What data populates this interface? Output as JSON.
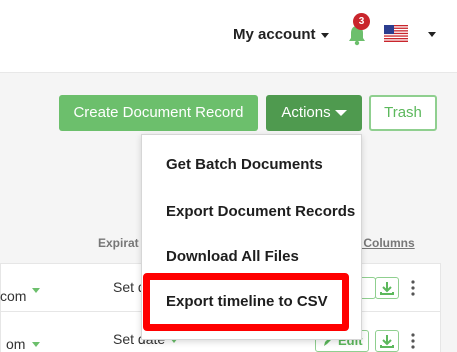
{
  "header": {
    "account_label": "My account",
    "notifications_count": "3",
    "flag": "us-flag-icon"
  },
  "toolbar": {
    "create_label": "Create Document Record",
    "actions_label": "Actions",
    "trash_label": "Trash"
  },
  "table": {
    "col_expiration": "Expirat",
    "col_columns": "t Columns",
    "rows": [
      {
        "email_fragment": "com",
        "expiry": "Set d"
      },
      {
        "email_fragment": "om",
        "expiry": "Set date",
        "edit_label": "Edit"
      }
    ]
  },
  "actions_menu": {
    "items": [
      "Get Batch Documents",
      "Export Document Records",
      "Download All Files",
      "Export timeline to CSV"
    ],
    "highlighted_item": "Export timeline to CSV"
  },
  "colors": {
    "primary_green": "#6cbf6c",
    "dark_green": "#4f9a4f",
    "badge_red": "#c9252c",
    "highlight_red": "#ff0000"
  }
}
